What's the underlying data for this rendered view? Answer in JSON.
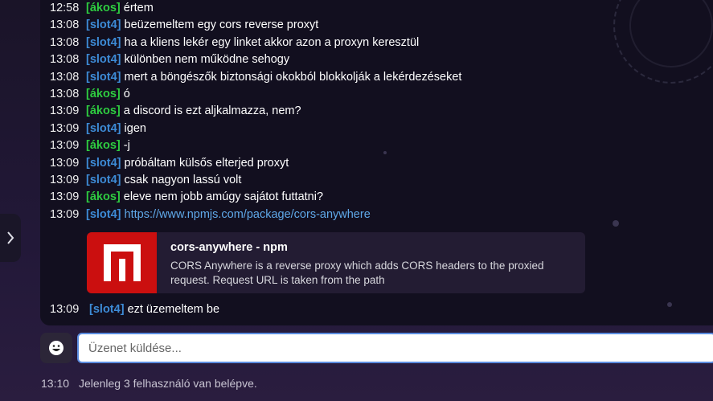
{
  "messages": [
    {
      "time": "12:58",
      "nick": "[ákos]",
      "cls": "akos",
      "text": "értem"
    },
    {
      "time": "13:08",
      "nick": "[slot4]",
      "cls": "slot4",
      "text": "beüzemeltem egy cors reverse proxyt"
    },
    {
      "time": "13:08",
      "nick": "[slot4]",
      "cls": "slot4",
      "text": "ha a kliens lekér egy linket akkor azon a proxyn keresztül"
    },
    {
      "time": "13:08",
      "nick": "[slot4]",
      "cls": "slot4",
      "text": "különben nem működne sehogy"
    },
    {
      "time": "13:08",
      "nick": "[slot4]",
      "cls": "slot4",
      "text": "mert a böngészők biztonsági okokból blokkolják a lekérdezéseket"
    },
    {
      "time": "13:08",
      "nick": "[ákos]",
      "cls": "akos",
      "text": "ó"
    },
    {
      "time": "13:09",
      "nick": "[ákos]",
      "cls": "akos",
      "text": "a discord is ezt aljkalmazza, nem?"
    },
    {
      "time": "13:09",
      "nick": "[slot4]",
      "cls": "slot4",
      "text": "igen"
    },
    {
      "time": "13:09",
      "nick": "[ákos]",
      "cls": "akos",
      "text": "-j"
    },
    {
      "time": "13:09",
      "nick": "[slot4]",
      "cls": "slot4",
      "text": "próbáltam külsős elterjed proxyt"
    },
    {
      "time": "13:09",
      "nick": "[slot4]",
      "cls": "slot4",
      "text": "csak nagyon lassú volt"
    },
    {
      "time": "13:09",
      "nick": "[ákos]",
      "cls": "akos",
      "text": "eleve nem jobb amúgy sajátot futtatni?"
    },
    {
      "time": "13:09",
      "nick": "[slot4]",
      "cls": "slot4",
      "text": "https://www.npmjs.com/package/cors-anywhere",
      "link": true
    }
  ],
  "embed": {
    "title": "cors-anywhere - npm",
    "description": "CORS Anywhere is a reverse proxy which adds CORS headers to the proxied request. Request URL is taken from the path"
  },
  "last_message": {
    "time": "13:09",
    "nick": "[slot4]",
    "text": "ezt üzemeltem be"
  },
  "composer": {
    "placeholder": "Üzenet küldése..."
  },
  "status": {
    "time": "13:10",
    "text": "Jelenleg 3 felhasználó van belépve."
  },
  "icons": {
    "emoji": "smiley-icon",
    "toggle": "chevron-right-icon",
    "brand": "npm-logo-icon"
  }
}
